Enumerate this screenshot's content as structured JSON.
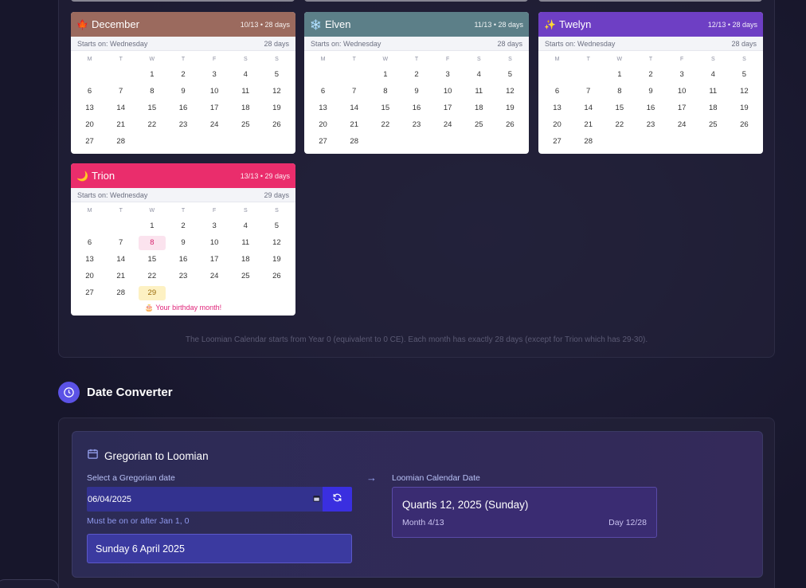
{
  "months": [
    {
      "name": "December",
      "icon": "🍁",
      "meta": "10/13 • 28 days",
      "color": "#9b6a5e",
      "starts": "Starts on: Wednesday",
      "days": "28 days",
      "length": 28,
      "highlight": null,
      "birthday": null,
      "note": ""
    },
    {
      "name": "Elven",
      "icon": "❄️",
      "meta": "11/13 • 28 days",
      "color": "#5c7f88",
      "starts": "Starts on: Wednesday",
      "days": "28 days",
      "length": 28,
      "highlight": null,
      "birthday": null,
      "note": ""
    },
    {
      "name": "Twelyn",
      "icon": "✨",
      "meta": "12/13 • 28 days",
      "color": "#6e3fc4",
      "starts": "Starts on: Wednesday",
      "days": "28 days",
      "length": 28,
      "highlight": null,
      "birthday": null,
      "note": ""
    },
    {
      "name": "Trion",
      "icon": "🌙",
      "meta": "13/13 • 29 days",
      "color": "#ea2d6c",
      "starts": "Starts on: Wednesday",
      "days": "29 days",
      "length": 29,
      "highlight": 8,
      "birthday": 29,
      "note": "🎂 Your birthday month!"
    }
  ],
  "weekdays": [
    "M",
    "T",
    "W",
    "T",
    "F",
    "S",
    "S"
  ],
  "footnote": "The Loomian Calendar starts from Year 0 (equivalent to 0 CE). Each month has exactly 28 days (except for Trion which has 29-30).",
  "converter": {
    "section_title": "Date Converter",
    "card_title": "Gregorian to Loomian",
    "input_label": "Select a Gregorian date",
    "input_value": "06/04/2025",
    "hint": "Must be on or after Jan 1, 0",
    "display": "Sunday 6 April 2025",
    "result_label": "Loomian Calendar Date",
    "result_main": "Quartis 12, 2025 (Sunday)",
    "result_month": "Month 4/13",
    "result_day": "Day 12/28"
  }
}
